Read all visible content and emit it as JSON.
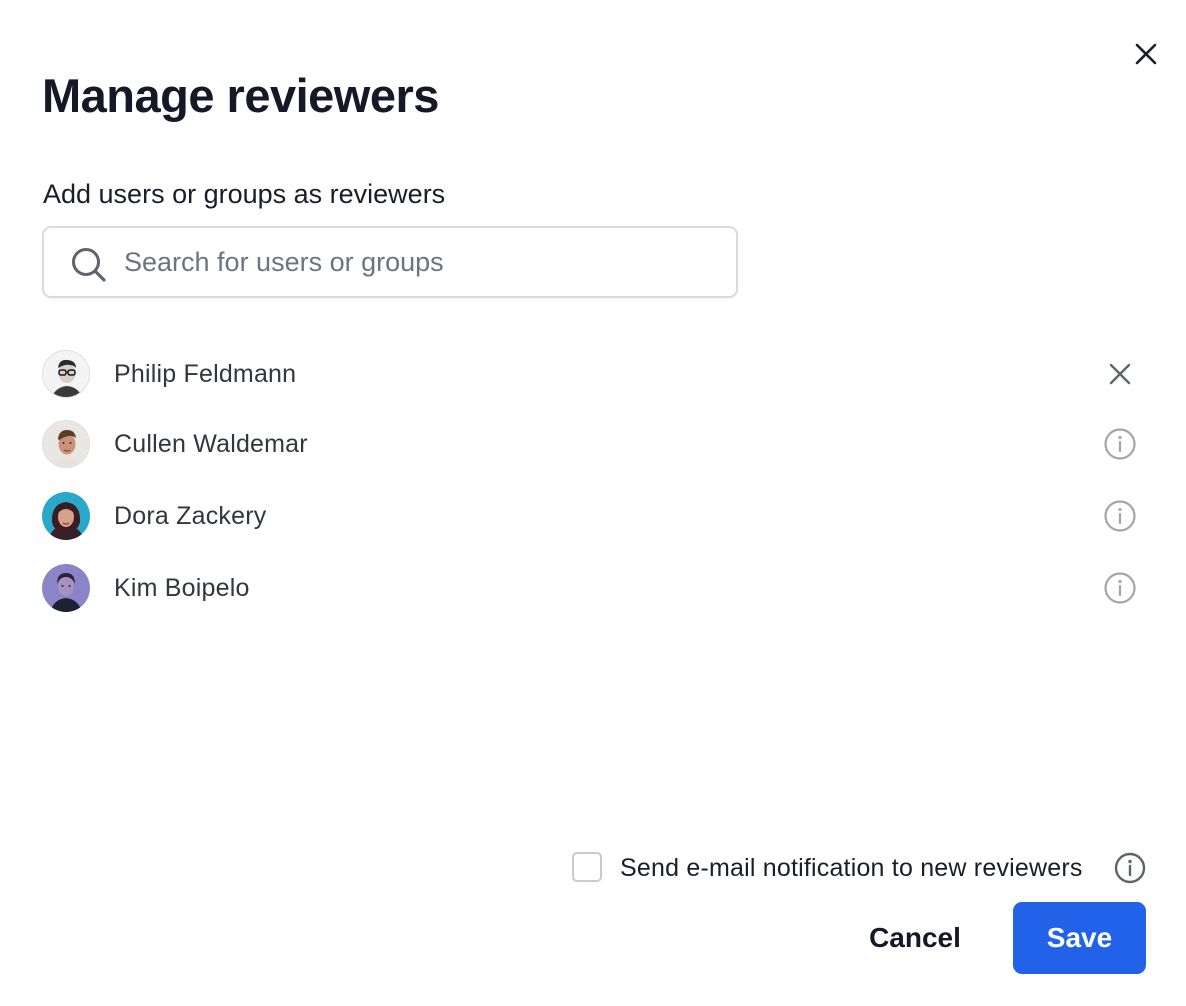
{
  "dialog": {
    "title": "Manage reviewers",
    "close_icon": "close-icon"
  },
  "search": {
    "label": "Add users or groups as reviewers",
    "placeholder": "Search for users or groups",
    "value": "",
    "icon": "search-icon"
  },
  "reviewers": [
    {
      "name": "Philip Feldmann",
      "action_icon": "remove-icon"
    },
    {
      "name": "Cullen Waldemar",
      "action_icon": "info-icon"
    },
    {
      "name": "Dora Zackery",
      "action_icon": "info-icon"
    },
    {
      "name": "Kim Boipelo",
      "action_icon": "info-icon"
    }
  ],
  "notification": {
    "label": "Send e-mail notification to new reviewers",
    "checked": false,
    "info_icon": "info-icon"
  },
  "footer": {
    "cancel_label": "Cancel",
    "save_label": "Save"
  },
  "colors": {
    "primary": "#2262e8",
    "text": "#1b1e29",
    "muted_icon": "#a3a6ad",
    "border": "#d9dbe1"
  }
}
